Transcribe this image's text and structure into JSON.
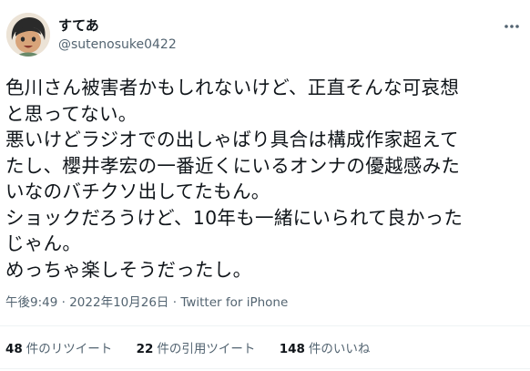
{
  "tweet": {
    "display_name": "すてあ",
    "handle": "@sutenosuke0422",
    "body_lines": [
      "色川さん被害者かもしれないけど、正直そんな可哀想",
      "と思ってない。",
      "悪いけどラジオでの出しゃばり具合は構成作家超えて",
      "たし、櫻井孝宏の一番近くにいるオンナの優越感みた",
      "いなのバチクソ出してたもん。",
      "ショックだろうけど、10年も一緒にいられて良かった",
      "じゃん。",
      "めっちゃ楽しそうだったし。"
    ],
    "time": "午後9:49",
    "separator": "·",
    "date": "2022年10月26日",
    "source": "Twitter for iPhone"
  },
  "stats": {
    "retweets_count": "48",
    "retweets_label": "件のリツイート",
    "quotes_count": "22",
    "quotes_label": "件の引用ツイート",
    "likes_count": "148",
    "likes_label": "件のいいね"
  },
  "icons": {
    "more": "more-horizontal-icon",
    "avatar": "avatar-illustration"
  },
  "colors": {
    "text": "#0f1419",
    "secondary": "#536471",
    "divider": "#eff3f4"
  }
}
